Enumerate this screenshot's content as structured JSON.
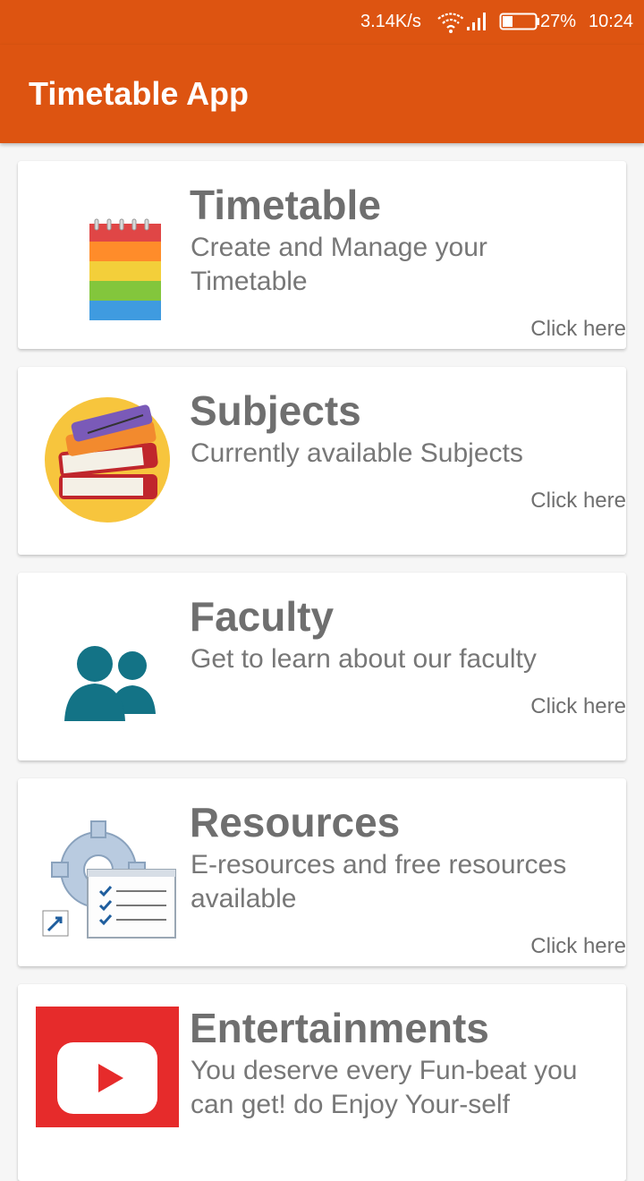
{
  "status_bar": {
    "net_speed": "3.14K/s",
    "battery_pct": "27%",
    "time": "10:24",
    "icons": [
      "wifi-icon",
      "signal-icon",
      "battery-icon"
    ]
  },
  "app_bar": {
    "title": "Timetable App"
  },
  "colors": {
    "primary": "#dd5411",
    "card_bg": "#ffffff",
    "text_gray": "#6f6f6f",
    "faculty_teal": "#137386",
    "youtube_red": "#e62b2b"
  },
  "cards": [
    {
      "title": "Timetable",
      "desc": "Create and Manage your Timetable",
      "link": "Click here",
      "icon": "notepad-icon"
    },
    {
      "title": "Subjects",
      "desc": "Currently available Subjects",
      "link": "Click here",
      "icon": "books-icon"
    },
    {
      "title": "Faculty",
      "desc": "Get to learn about our faculty",
      "link": "Click here",
      "icon": "people-icon"
    },
    {
      "title": "Resources",
      "desc": "E-resources and free resources available",
      "link": "Click here",
      "icon": "resources-gear-icon"
    },
    {
      "title": "Entertainments",
      "desc": "You deserve every Fun-beat you can get! do Enjoy Your-self",
      "icon": "youtube-icon"
    }
  ]
}
